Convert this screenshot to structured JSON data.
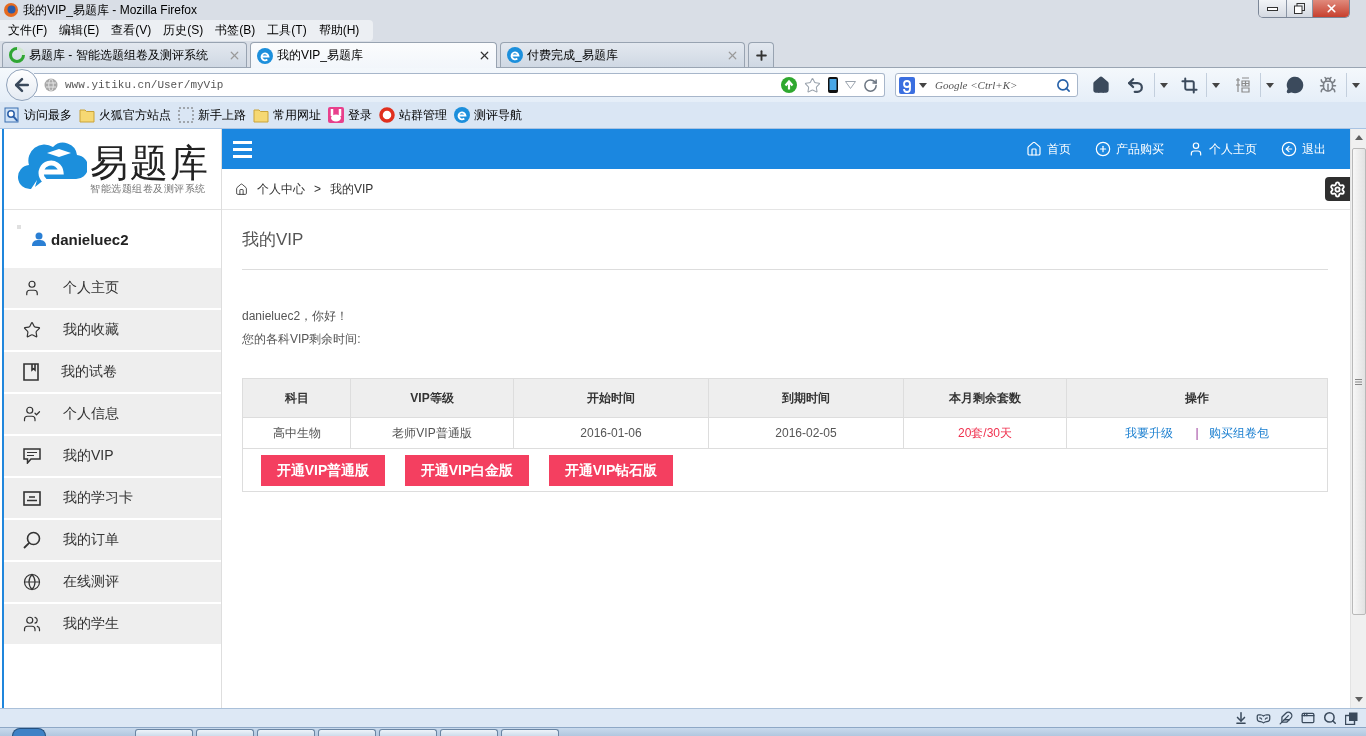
{
  "window": {
    "title": "我的VIP_易题库 - Mozilla Firefox"
  },
  "menu_bar": [
    "文件(F)",
    "编辑(E)",
    "查看(V)",
    "历史(S)",
    "书签(B)",
    "工具(T)",
    "帮助(H)"
  ],
  "tabs": [
    {
      "label": "易题库 - 智能选题组卷及测评系统",
      "selected": false,
      "loading": true
    },
    {
      "label": "我的VIP_易题库",
      "selected": true,
      "loading": false
    },
    {
      "label": "付费完成_易题库",
      "selected": false,
      "loading": false
    }
  ],
  "address_bar": {
    "url": "www.yitiku.cn/User/myVip"
  },
  "search": {
    "placeholder": "Google <Ctrl+K>"
  },
  "bookmarks": [
    {
      "label": "访问最多",
      "kind": "smart"
    },
    {
      "label": "火狐官方站点",
      "kind": "folder"
    },
    {
      "label": "新手上路",
      "kind": "page"
    },
    {
      "label": "常用网址",
      "kind": "folder"
    },
    {
      "label": "登录",
      "kind": "bunny"
    },
    {
      "label": "站群管理",
      "kind": "ring"
    },
    {
      "label": "测评导航",
      "kind": "swirl"
    }
  ],
  "site": {
    "logo": {
      "name": "易题库",
      "tagline": "智能选题组卷及测评系统"
    },
    "user": {
      "name": "danieluec2"
    },
    "sidebar": {
      "items": [
        {
          "label": "个人主页",
          "kind": "person"
        },
        {
          "label": "我的收藏",
          "kind": "star"
        },
        {
          "label": "我的试卷",
          "kind": "paper"
        },
        {
          "label": "个人信息",
          "kind": "person_check"
        },
        {
          "label": "我的VIP",
          "kind": "vip"
        },
        {
          "label": "我的学习卡",
          "kind": "card"
        },
        {
          "label": "我的订单",
          "kind": "search"
        },
        {
          "label": "在线测评",
          "kind": "globe"
        },
        {
          "label": "我的学生",
          "kind": "people"
        }
      ]
    },
    "top_nav": [
      {
        "label": "首页",
        "kind": "home"
      },
      {
        "label": "产品购买",
        "kind": "plus"
      },
      {
        "label": "个人主页",
        "kind": "person"
      },
      {
        "label": "退出",
        "kind": "logout"
      }
    ],
    "breadcrumb": {
      "items": [
        "个人中心",
        "我的VIP"
      ],
      "separator": ">"
    },
    "page": {
      "title": "我的VIP",
      "greeting": "danieluec2，你好！",
      "note": "您的各科VIP剩余时间:"
    },
    "table": {
      "columns": [
        "科目",
        "VIP等级",
        "开始时间",
        "到期时间",
        "本月剩余套数",
        "操作"
      ],
      "rows": [
        {
          "subject": "高中生物",
          "vip_grade": "老师VIP普通版",
          "start_date": "2016-01-06",
          "end_date": "2016-02-05",
          "remaining": "20套/30天",
          "actions": [
            "我要升级",
            "购买组卷包"
          ]
        }
      ],
      "action_separator": "|"
    },
    "buttons": [
      "开通VIP普通版",
      "开通VIP白金版",
      "开通VIP钻石版"
    ]
  }
}
